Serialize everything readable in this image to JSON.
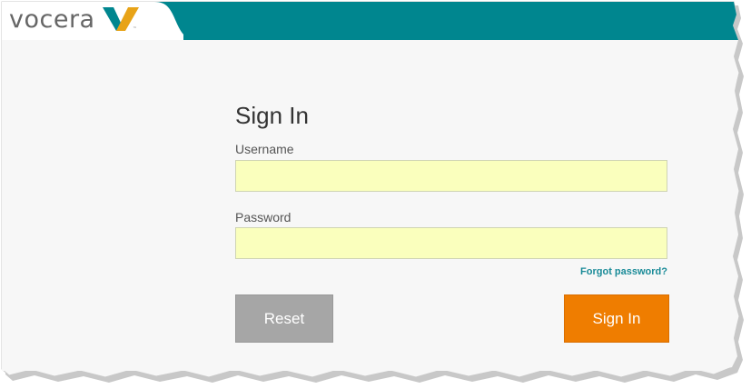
{
  "brand": {
    "logo_text": "vocera",
    "header_color": "#00868f",
    "accent_color": "#ef7d00",
    "logo_mark_colors": [
      "#00868f",
      "#e8a317"
    ]
  },
  "form": {
    "title": "Sign In",
    "username_label": "Username",
    "username_value": "",
    "password_label": "Password",
    "password_value": "",
    "forgot_link": "Forgot password?",
    "reset_label": "Reset",
    "signin_label": "Sign In"
  }
}
